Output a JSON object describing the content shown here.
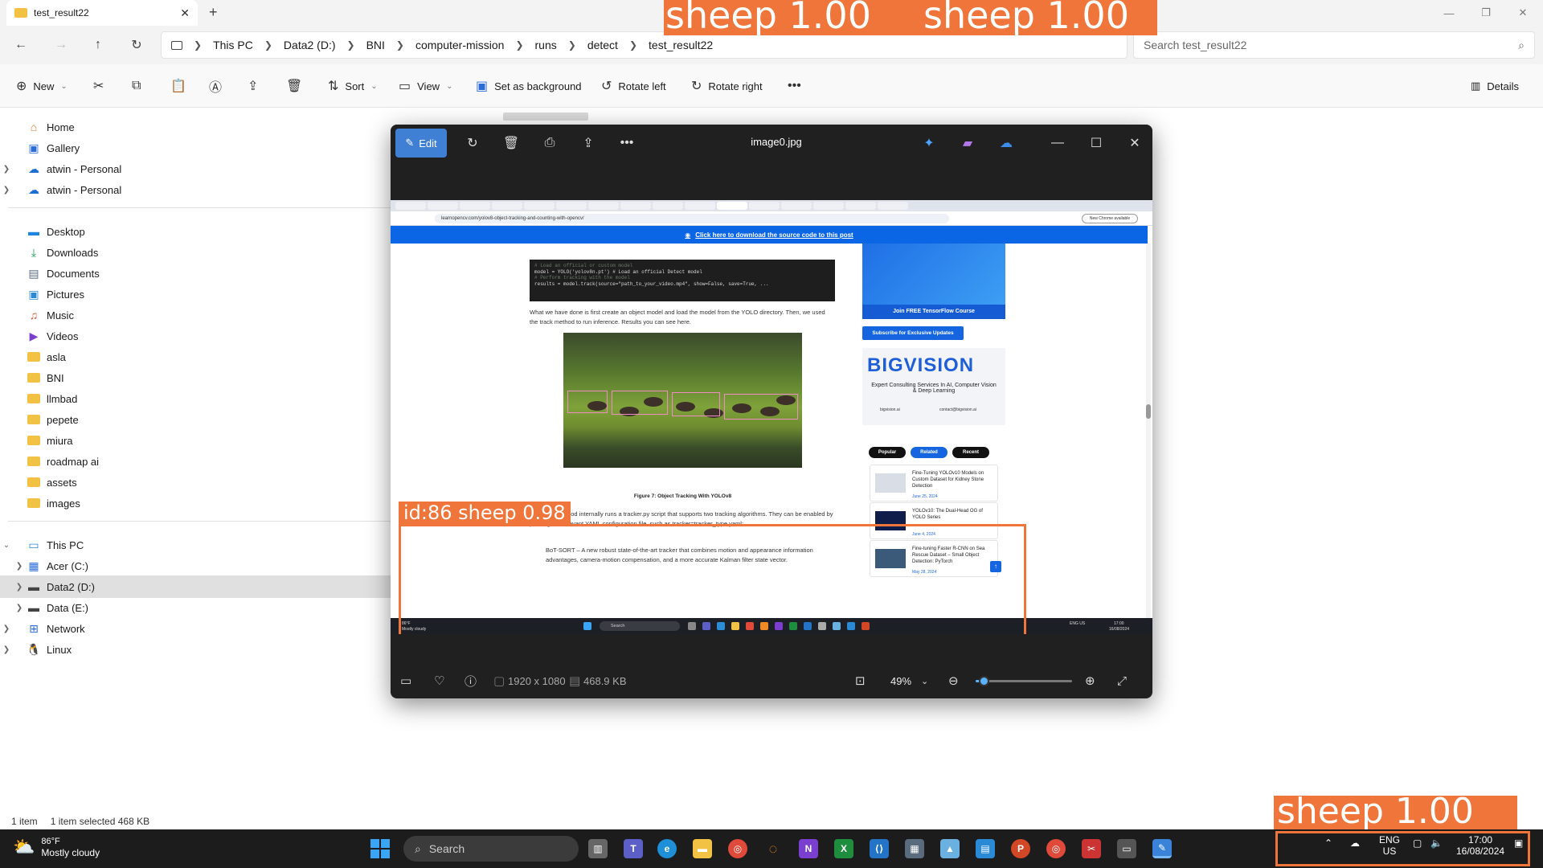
{
  "explorer": {
    "tab_title": "test_result22",
    "breadcrumb": [
      "This PC",
      "Data2 (D:)",
      "BNI",
      "computer-mission",
      "runs",
      "detect",
      "test_result22"
    ],
    "search_placeholder": "Search test_result22",
    "toolbar": {
      "new_label": "New",
      "sort_label": "Sort",
      "view_label": "View",
      "set_background_label": "Set as background",
      "rotate_left_label": "Rotate left",
      "rotate_right_label": "Rotate right",
      "details_label": "Details"
    },
    "sidebar": {
      "quick": [
        "Home",
        "Gallery",
        "atwin - Personal",
        "atwin - Personal"
      ],
      "pinned": [
        "Desktop",
        "Downloads",
        "Documents",
        "Pictures",
        "Music",
        "Videos",
        "asla",
        "BNI",
        "llmbad",
        "pepete",
        "miura",
        "roadmap ai",
        "assets",
        "images"
      ],
      "this_pc": "This PC",
      "drives": [
        "Acer (C:)",
        "Data2 (D:)",
        "Data (E:)"
      ],
      "network": "Network",
      "linux": "Linux"
    },
    "status": {
      "count": "1 item",
      "selection": "1 item selected  468 KB"
    }
  },
  "viewer": {
    "edit_label": "Edit",
    "filename": "image0.jpg",
    "dimensions": "1920 x 1080",
    "filesize": "468.9 KB",
    "zoom": "49%",
    "zoom_level": 0.08
  },
  "embedded": {
    "url": "learnopencv.com/yolov8-object-tracking-and-counting-with-opencv/",
    "chrome_button": "New Chrome available",
    "banner": "Click here to download the source code to this post",
    "code": [
      "# Load an official or custom model",
      "model = YOLO('yolov8n.pt')  # Load an official Detect model",
      "",
      "# Perform tracking with the model",
      "results = model.track(source=\"path_to_your_video.mp4\", show=False, save=True, ..."
    ],
    "para1": "What we have done is first create an object model and load the model from the YOLO directory. Then, we used the track method to run inference. Results you can see here.",
    "figure_caption": "Figure 7: Object Tracking With YOLOv8",
    "para2": "This track method internally runs a tracker.py script that supports two tracking algorithms. They can be enabled by passing the relevant YAML configuration file, such as tracker=tracker_type.yaml:",
    "bullet1": "BoT-SORT – A new robust state-of-the-art tracker that combines motion and appearance information advantages, camera-motion compensation, and a more accurate Kalman filter state vector.",
    "tf_button": "Join FREE TensorFlow Course",
    "subscribe": "Subscribe for Exclusive Updates",
    "bigvision_logo": "BIGVISION",
    "bigvision_tag": "Expert Consulting Services In AI, Computer Vision & Deep Learning",
    "bigvision_contact1": "bigvision.ai",
    "bigvision_contact2": "contact@bigvision.ai",
    "pills": [
      "Popular",
      "Related",
      "Recent"
    ],
    "cards": [
      {
        "title": "Fine-Tuning YOLOv10 Models on Custom Dataset for Kidney Stone Detection",
        "date": "June 25, 2024"
      },
      {
        "title": "YOLOv10: The Dual-Head OG of YOLO Series",
        "date": "June 4, 2024"
      },
      {
        "title": "Fine-tuning Faster R-CNN on Sea Rescue Dataset – Small Object Detection: PyTorch",
        "date": "May 28, 2024"
      }
    ],
    "taskbar_weather_temp": "86°F",
    "taskbar_weather_cond": "Mostly cloudy",
    "taskbar_search": "Search",
    "taskbar_lang": "ENG US",
    "taskbar_time": "17:00",
    "taskbar_date": "16/08/2024",
    "det_label": "id:86  sheep  0.98"
  },
  "detections": {
    "top_left": "sheep  1.00",
    "top_right": "sheep  1.00",
    "bottom_right": "sheep  1.00"
  },
  "taskbar": {
    "weather_temp": "86°F",
    "weather_cond": "Mostly cloudy",
    "search": "Search",
    "lang1": "ENG",
    "lang2": "US",
    "time": "17:00",
    "date": "16/08/2024"
  }
}
